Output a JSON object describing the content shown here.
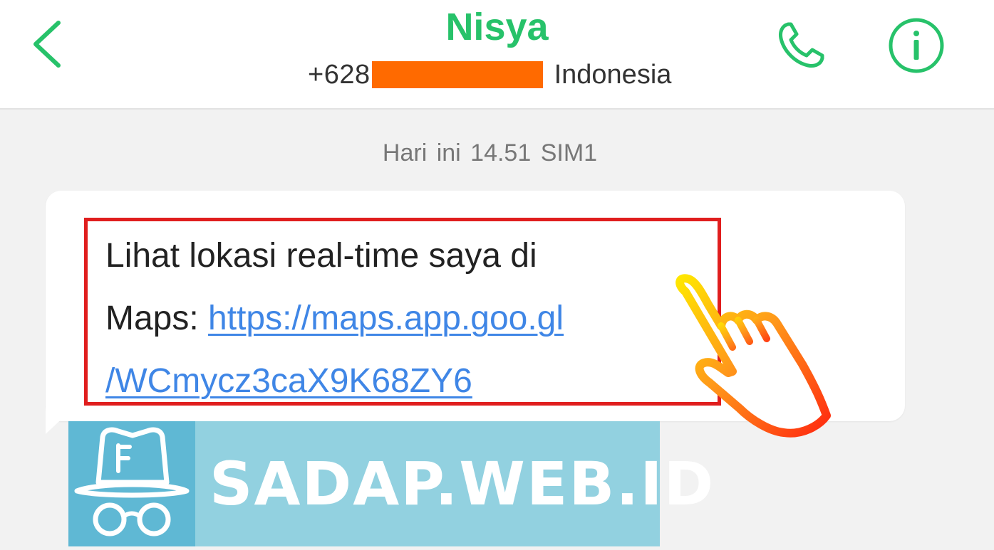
{
  "header": {
    "contact_name": "Nisya",
    "phone_prefix": "+628",
    "country": "Indonesia",
    "back_icon": "chevron-left-icon",
    "call_icon": "phone-icon",
    "info_icon": "info-icon"
  },
  "conversation": {
    "timestamp": "Hari ini 14.51  SIM1",
    "message": {
      "text_line_1": "Lihat lokasi real-time saya di",
      "text_line_2_prefix": "Maps: ",
      "link_part_1": "https://maps.app.goo.gl",
      "link_part_2": "/WCmycz3caX9K68ZY6"
    },
    "pointer_icon": "hand-pointer-icon"
  },
  "watermark": {
    "text": "SADAP.WEB.ID",
    "logo_icon": "spy-hat-glasses-icon"
  },
  "colors": {
    "accent_green": "#27c26a",
    "link_blue": "#3f86e6",
    "highlight_red": "#e01e1e",
    "redaction_orange": "#ff6a00",
    "watermark_dark": "#5fb8d4",
    "watermark_light": "#92d1e0"
  }
}
